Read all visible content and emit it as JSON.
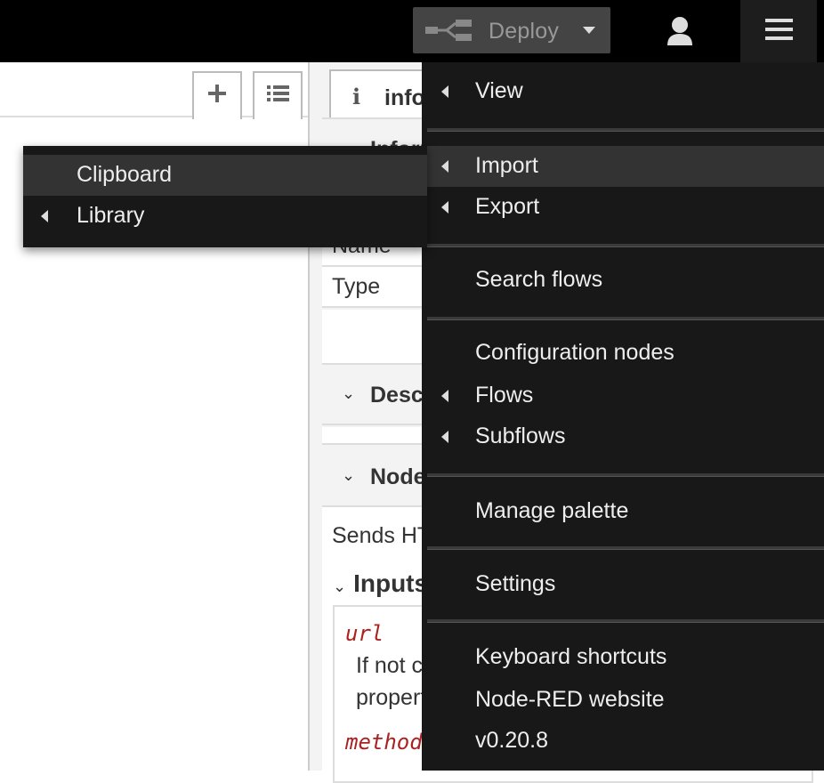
{
  "header": {
    "deploy_label": "Deploy",
    "deploy_icon": "deploy-icon",
    "user_icon": "user-icon",
    "menu_icon": "hamburger-menu-icon",
    "colors": {
      "header_bg": "#000000",
      "deploy_bg": "#444444",
      "menu_bg": "#181818"
    }
  },
  "workspace": {
    "add_tab_icon": "plus-icon",
    "list_tabs_icon": "list-icon"
  },
  "sidebar": {
    "tab_label": "info",
    "info_section": "Information",
    "rows": [
      {
        "label": "Name"
      },
      {
        "label": "Type"
      }
    ],
    "description_section": "Description",
    "node_help_section": "Node help",
    "help_summary": "Sends HTTP requests",
    "inputs_header": "Inputs",
    "props": [
      {
        "name": "url",
        "desc_line1": "If not configured in the node, this optional",
        "desc_line2": "property sets the url of the request."
      },
      {
        "name": "method"
      }
    ]
  },
  "main_menu": {
    "items": [
      {
        "label": "View",
        "has_submenu": true
      },
      {
        "label": "Import",
        "has_submenu": true,
        "active": true
      },
      {
        "label": "Export",
        "has_submenu": true
      },
      {
        "label": "Search flows",
        "has_submenu": false
      },
      {
        "label": "Configuration nodes",
        "has_submenu": false
      },
      {
        "label": "Flows",
        "has_submenu": true
      },
      {
        "label": "Subflows",
        "has_submenu": true
      },
      {
        "label": "Manage palette",
        "has_submenu": false
      },
      {
        "label": "Settings",
        "has_submenu": false
      },
      {
        "label": "Keyboard shortcuts",
        "has_submenu": false
      },
      {
        "label": "Node-RED website",
        "has_submenu": false
      },
      {
        "label": "v0.20.8",
        "has_submenu": false
      }
    ]
  },
  "import_submenu": {
    "items": [
      {
        "label": "Clipboard",
        "has_submenu": false,
        "active": true
      },
      {
        "label": "Library",
        "has_submenu": true
      }
    ]
  }
}
